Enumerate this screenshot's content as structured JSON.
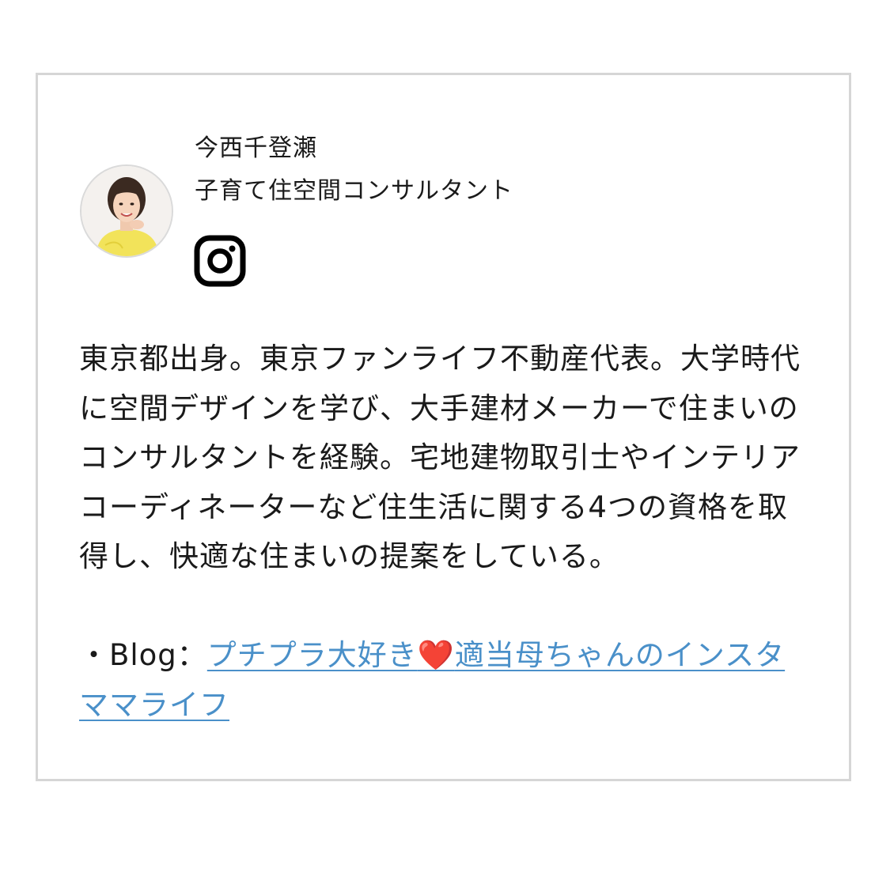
{
  "author": {
    "name": "今西千登瀬",
    "title": "子育て住空間コンサルタント",
    "avatar_icon": "author-photo",
    "social_icon": "instagram-icon"
  },
  "bio": {
    "text": "東京都出身。東京ファンライフ不動産代表。大学時代に空間デザインを学び、大手建材メーカーで住まいのコンサルタントを経験。宅地建物取引士やインテリアコーディネーターなど住生活に関する4つの資格を取得し、快適な住まいの提案をしている。"
  },
  "blog": {
    "prefix": "・Blog：",
    "link_part1": "プチプラ大好き",
    "heart": "❤️",
    "link_part2": "適当母ちゃんのインスタママライフ"
  },
  "colors": {
    "link": "#4a90c9",
    "border": "#d6d6d6",
    "heart": "#d9262c"
  }
}
